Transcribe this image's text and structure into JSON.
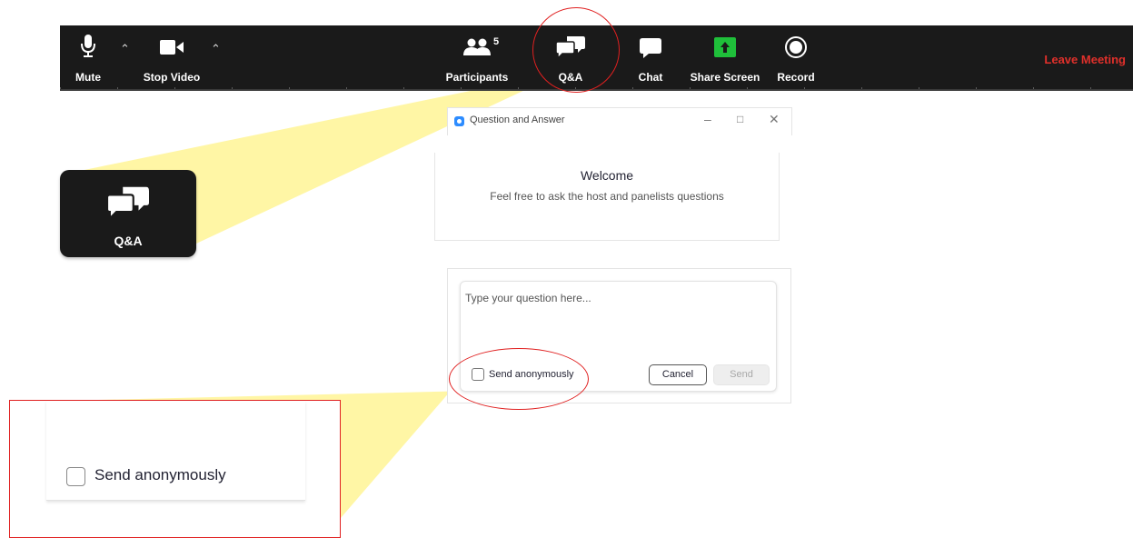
{
  "toolbar": {
    "mute_label": "Mute",
    "stop_video_label": "Stop Video",
    "participants_label": "Participants",
    "participants_count": "5",
    "qa_label": "Q&A",
    "chat_label": "Chat",
    "share_screen_label": "Share Screen",
    "record_label": "Record",
    "leave_label": "Leave Meeting"
  },
  "zoomed_qa": {
    "label": "Q&A"
  },
  "qa_window": {
    "title": "Question and Answer",
    "welcome_title": "Welcome",
    "welcome_subtitle": "Feel free to ask the host and panelists questions",
    "input_placeholder": "Type your question here...",
    "anonymous_label": "Send anonymously",
    "cancel_label": "Cancel",
    "send_label": "Send"
  },
  "zoomed_checkbox": {
    "label": "Send anonymously"
  },
  "colors": {
    "toolbar_bg": "#1a1a1a",
    "leave_red": "#e0302b",
    "share_green": "#1fbf3a",
    "highlight_red": "#e02020",
    "beam_yellow": "#fff6a0",
    "zoom_blue": "#2d8cff"
  }
}
